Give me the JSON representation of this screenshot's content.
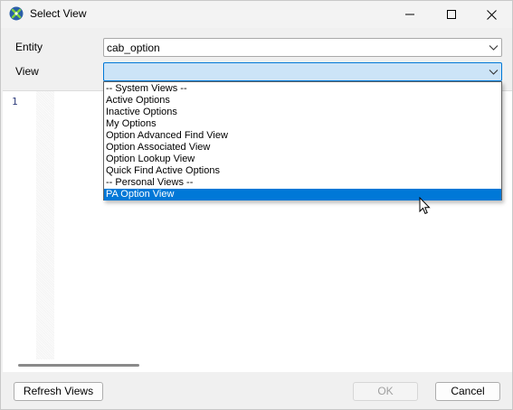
{
  "window": {
    "title": "Select View",
    "app_icon": "xrm-toolbox-icon",
    "controls": [
      "minimize-icon",
      "maximize-icon",
      "close-icon"
    ]
  },
  "form": {
    "entity_label": "Entity",
    "entity_value": "cab_option",
    "view_label": "View",
    "view_value": ""
  },
  "dropdown": {
    "items": [
      "-- System Views --",
      "Active Options",
      "Inactive Options",
      "My Options",
      "Option Advanced Find View",
      "Option Associated View",
      "Option Lookup View",
      "Quick Find Active Options",
      "-- Personal Views --",
      "PA Option View"
    ],
    "selected_index": 9
  },
  "editor": {
    "line_numbers": [
      "1"
    ]
  },
  "buttons": {
    "refresh": "Refresh Views",
    "ok": "OK",
    "cancel": "Cancel"
  },
  "colors": {
    "selection": "#0078d7",
    "focused_combo": "#cce4f7"
  }
}
